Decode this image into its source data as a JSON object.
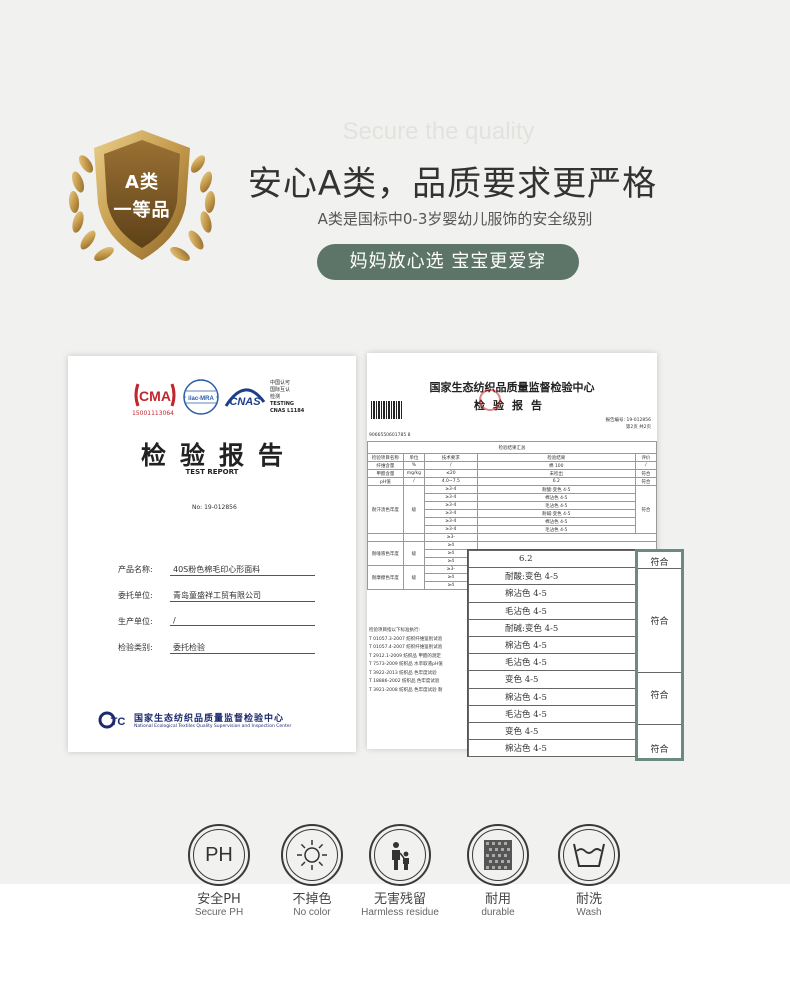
{
  "badge": {
    "line1": "A类",
    "line2": "一等品",
    "colors": {
      "gold": "#c9a35a",
      "dark": "#7a5a22"
    }
  },
  "header": {
    "title_en": "Secure the quality",
    "title_cn": "安心A类，品质要求更严格",
    "subtitle": "A类是国标中0-3岁婴幼儿服饰的安全级别",
    "pill": "妈妈放心选 宝宝更爱穿",
    "accent": "#5d7569"
  },
  "cert1": {
    "cma_text": "CMA",
    "cma_number": "15001113064",
    "ilac_text": "ilac-MRA",
    "cnas_text": "CNAS",
    "cnas_right": [
      "中国认可",
      "国际互认",
      "检测",
      "TESTING",
      "CNAS L1184"
    ],
    "title": "检验报告",
    "title_en": "TEST REPORT",
    "report_no": "No: 19-012856",
    "fields": [
      {
        "label": "产品名称:",
        "value": "40S粉色棉毛印心形面料"
      },
      {
        "label": "委托单位:",
        "value": "青岛童盛祥工贸有限公司"
      },
      {
        "label": "生产单位:",
        "value": "/"
      },
      {
        "label": "检验类别:",
        "value": "委托检验"
      }
    ],
    "org_cn": "国家生态纺织品质量监督检验中心",
    "org_en": "National Ecological Textiles Quality Supervision and Inspection Center",
    "logo_text": "QTC"
  },
  "cert2": {
    "title": "国家生态纺织品质量监督检验中心",
    "subtitle": "检验报告",
    "meta1": "报告编号: 19-012856",
    "meta2": "第2页 共2页",
    "serial": "9066550601785 8",
    "summary_title": "检验结果汇总",
    "headers": [
      "检验项目名称",
      "单位",
      "技术要求",
      "检验结果",
      "评价"
    ],
    "rows": [
      [
        "纤维含量",
        "%",
        "/",
        "棉 100",
        "/"
      ],
      [
        "甲醛含量",
        "mg/kg",
        "≤20",
        "未检出",
        "符合"
      ],
      [
        "pH值",
        "/",
        "4.0~7.5",
        "6.2",
        "符合"
      ]
    ],
    "group1_label": "耐汗渍色牢度",
    "group1_unit": "级",
    "group1_req": [
      "≥3-4",
      "≥3-4",
      "≥3-4",
      "≥3-4",
      "≥3-4",
      "≥3-4"
    ],
    "group1_res": [
      "耐酸:变色 4-5",
      "棉沾色 4-5",
      "毛沾色 4-5",
      "耐碱:变色 4-5",
      "棉沾色 4-5",
      "毛沾色 4-5"
    ],
    "group1_eval": "符合",
    "group2_label": "耐唾液色牢度",
    "group3_label": "耐摩擦色牢度",
    "req_short": [
      "≥3-",
      "≥4",
      "≥4",
      "≥4",
      "≥3-",
      "≥4",
      "≥4"
    ],
    "unit_short": "级",
    "standards": [
      "检验项目指以下标准执行:",
      "T 01057.3-2007 纺织纤维鉴别试验",
      "T 01057.4-2007 纺织纤维鉴别试验",
      "T 2912.1-2009 纺织品 甲醛的测定",
      "T 7573-2009 纺织品 水萃取液pH值",
      "T 3922-2013 纺织品 色牢度试验",
      "T 18886-2002 纺织品 色牢度试验",
      "T 3921-2008 纺织品 色牢度试验 耐"
    ]
  },
  "zoom": {
    "rows": [
      "6.2",
      "耐酸:变色 4-5",
      "棉沾色 4-5",
      "毛沾色 4-5",
      "耐碱:变色 4-5",
      "棉沾色 4-5",
      "毛沾色 4-5",
      "变色 4-5",
      "棉沾色 4-5",
      "毛沾色 4-5",
      "变色 4-5",
      "棉沾色 4-5"
    ],
    "results": [
      "符合",
      "符合",
      "符合",
      "符合"
    ],
    "frame_color": "#6d8a82"
  },
  "features": [
    {
      "icon": "ph-icon",
      "icon_text": "PH",
      "cn": "安全PH",
      "en": "Secure PH"
    },
    {
      "icon": "sun-icon",
      "cn": "不掉色",
      "en": "No color"
    },
    {
      "icon": "family-icon",
      "cn": "无害残留",
      "en": "Harmless residue"
    },
    {
      "icon": "fabric-icon",
      "cn": "耐用",
      "en": "durable"
    },
    {
      "icon": "wash-icon",
      "cn": "耐洗",
      "en": "Wash"
    }
  ]
}
